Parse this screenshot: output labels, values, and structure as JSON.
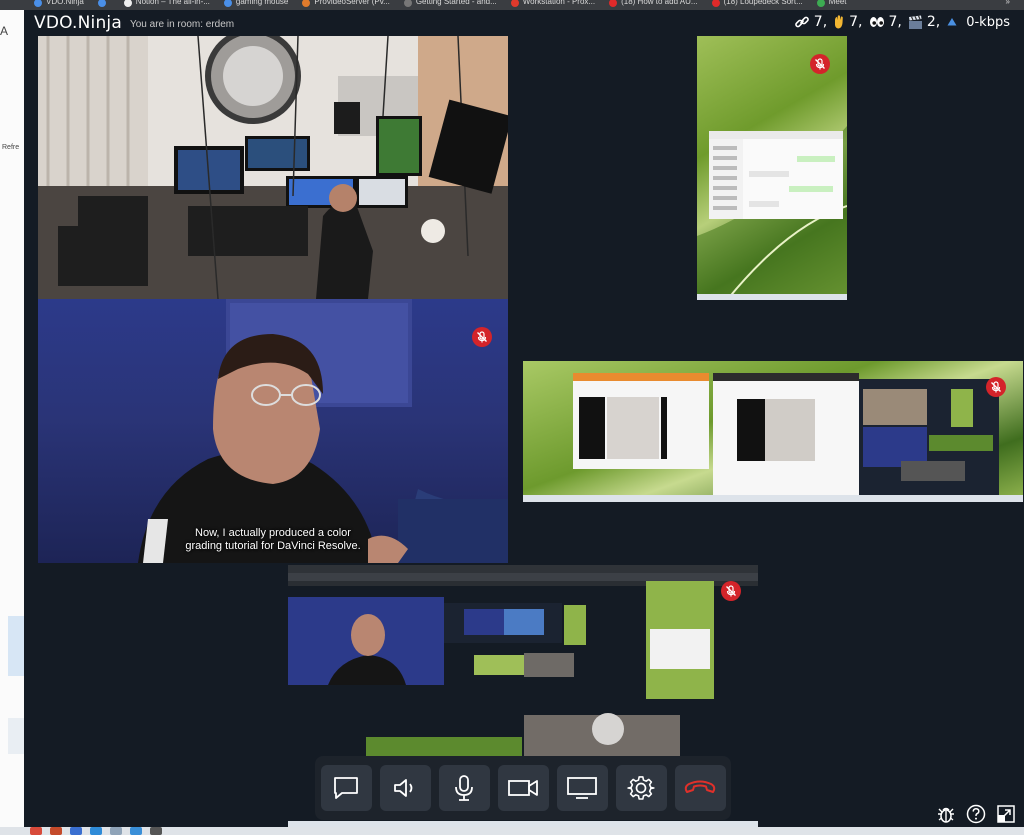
{
  "browser": {
    "bookmarks": [
      {
        "label": "VDO.Ninja",
        "color": "#4a8fe7"
      },
      {
        "label": "",
        "color": "#4a8fe7"
      },
      {
        "label": "Notion – The all-in-...",
        "color": "#eeeeee"
      },
      {
        "label": "gaming mouse",
        "color": "#4a8fe7"
      },
      {
        "label": "ProvideoServer (Pv...",
        "color": "#e07b2c"
      },
      {
        "label": "Getting Started - and...",
        "color": "#777777"
      },
      {
        "label": "Workstation - Prox...",
        "color": "#e03a2c"
      },
      {
        "label": "(18) How to add AU...",
        "color": "#e02a2a"
      },
      {
        "label": "(18) Loupedeck Sort...",
        "color": "#e02a2a"
      },
      {
        "label": "Meet",
        "color": "#3dab52"
      }
    ],
    "overflow": "»"
  },
  "underlying": {
    "left_glyph": "A",
    "refresh_text": "Refre"
  },
  "app": {
    "title": "VDO.Ninja",
    "room_text": "You are in room: erdem",
    "stats": [
      {
        "icon": "link-icon",
        "value": "7,"
      },
      {
        "icon": "hand-icon",
        "value": "7,"
      },
      {
        "icon": "eyes-icon",
        "value": "7,"
      },
      {
        "icon": "clapper-icon",
        "value": "2,"
      },
      {
        "icon": "upload-arrow-icon",
        "value": "0-kbps"
      }
    ]
  },
  "tiles": {
    "speaker_subtitle_line1": "Now, I actually produced a color",
    "speaker_subtitle_line2": "grading tutorial for DaVinci Resolve."
  },
  "controls": [
    {
      "name": "chat-button",
      "icon": "chat-icon"
    },
    {
      "name": "speaker-button",
      "icon": "speaker-icon"
    },
    {
      "name": "mic-button",
      "icon": "mic-icon"
    },
    {
      "name": "camera-button",
      "icon": "camera-icon"
    },
    {
      "name": "screenshare-button",
      "icon": "monitor-icon"
    },
    {
      "name": "settings-button",
      "icon": "gear-icon"
    },
    {
      "name": "hangup-button",
      "icon": "hangup-icon"
    }
  ],
  "colors": {
    "app_bg": "#141b24",
    "mute_red": "#d4242a",
    "hangup_red": "#e0302a",
    "control_bg": "#303741"
  }
}
